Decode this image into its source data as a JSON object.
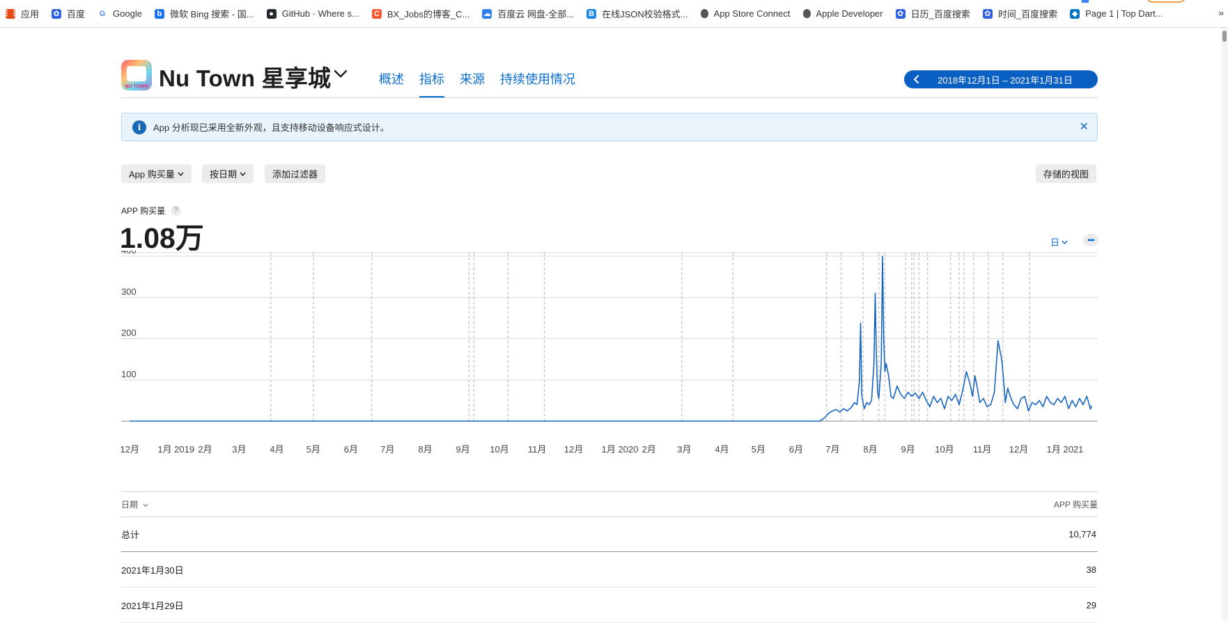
{
  "bookmarks": [
    {
      "label": "应用",
      "icon": "apps-grid-icon",
      "color": "#e64a19"
    },
    {
      "label": "百度",
      "icon": "baidu-paw-icon",
      "color": "#3062e0"
    },
    {
      "label": "Google",
      "icon": "google-icon",
      "color": "#4285f4"
    },
    {
      "label": "微软 Bing 搜索 - 国...",
      "icon": "bing-icon",
      "color": "#1a73e8"
    },
    {
      "label": "GitHub · Where s...",
      "icon": "github-icon",
      "color": "#24292e"
    },
    {
      "label": "BX_Jobs的博客_C...",
      "icon": "csdn-icon",
      "color": "#fc5531"
    },
    {
      "label": "百度云 网盘-全部...",
      "icon": "baidu-cloud-icon",
      "color": "#2f80ed"
    },
    {
      "label": "在线JSON校验格式...",
      "icon": "json-icon",
      "color": "#1e88e5"
    },
    {
      "label": "App Store Connect",
      "icon": "apple-icon",
      "color": "#333333"
    },
    {
      "label": "Apple Developer",
      "icon": "apple-icon",
      "color": "#333333"
    },
    {
      "label": "日历_百度搜索",
      "icon": "baidu-paw-icon",
      "color": "#3062e0"
    },
    {
      "label": "时间_百度搜索",
      "icon": "baidu-paw-icon",
      "color": "#3062e0"
    },
    {
      "label": "Page 1 | Top Dart...",
      "icon": "dart-icon",
      "color": "#0175c2"
    }
  ],
  "bookmarks_more": "»",
  "header": {
    "app_title": "Nu Town 星享城",
    "app_icon_caption": "NU TOWN",
    "tabs": [
      {
        "label": "概述",
        "active": false
      },
      {
        "label": "指标",
        "active": true
      },
      {
        "label": "来源",
        "active": false
      },
      {
        "label": "持续使用情况",
        "active": false
      }
    ],
    "date_range": "2018年12月1日 – 2021年1月31日"
  },
  "banner": {
    "text": "App 分析现已采用全新外观，且支持移动设备响应式设计。",
    "close": "✕"
  },
  "filters": {
    "metric": "App 购买量",
    "group_by": "按日期",
    "add_filter": "添加过滤器",
    "saved_views": "存储的视图"
  },
  "metric": {
    "label": "APP 购买量",
    "help": "?",
    "value": "1.08万",
    "granularity": "日",
    "more": "•••"
  },
  "colors": {
    "accent": "#0a6dd0",
    "line": "#1565c0",
    "pill": "#0a5fc2"
  },
  "chart_data": {
    "type": "line",
    "ylim": [
      0,
      400
    ],
    "y_ticks": [
      100,
      200,
      300,
      400
    ],
    "x_tick_labels": [
      "12月",
      "1月 2019",
      "2月",
      "3月",
      "4月",
      "5月",
      "6月",
      "7月",
      "8月",
      "9月",
      "10月",
      "11月",
      "12月",
      "1月 2020",
      "2月",
      "3月",
      "4月",
      "5月",
      "6月",
      "7月",
      "8月",
      "9月",
      "10月",
      "11月",
      "12月",
      "1月 2021"
    ],
    "series": [
      {
        "x": [
          "2018-12-01",
          "2020-06-20",
          "2020-06-22",
          "2020-06-25",
          "2020-06-28",
          "2020-07-01",
          "2020-07-04",
          "2020-07-07",
          "2020-07-10",
          "2020-07-13",
          "2020-07-16",
          "2020-07-19",
          "2020-07-21",
          "2020-07-23",
          "2020-07-24",
          "2020-07-25",
          "2020-07-27",
          "2020-07-29",
          "2020-07-31",
          "2020-08-02",
          "2020-08-04",
          "2020-08-05",
          "2020-08-06",
          "2020-08-07",
          "2020-08-08",
          "2020-08-10",
          "2020-08-11",
          "2020-08-12",
          "2020-08-13",
          "2020-08-14",
          "2020-08-16",
          "2020-08-18",
          "2020-08-20",
          "2020-08-23",
          "2020-08-26",
          "2020-08-29",
          "2020-09-01",
          "2020-09-04",
          "2020-09-07",
          "2020-09-10",
          "2020-09-13",
          "2020-09-16",
          "2020-09-19",
          "2020-09-22",
          "2020-09-25",
          "2020-09-28",
          "2020-10-01",
          "2020-10-04",
          "2020-10-07",
          "2020-10-10",
          "2020-10-13",
          "2020-10-16",
          "2020-10-19",
          "2020-10-22",
          "2020-10-24",
          "2020-10-26",
          "2020-10-28",
          "2020-10-30",
          "2020-11-02",
          "2020-11-05",
          "2020-11-08",
          "2020-11-11",
          "2020-11-14",
          "2020-11-17",
          "2020-11-19",
          "2020-11-20",
          "2020-11-22",
          "2020-11-24",
          "2020-11-27",
          "2020-11-30",
          "2020-12-03",
          "2020-12-06",
          "2020-12-09",
          "2020-12-12",
          "2020-12-15",
          "2020-12-18",
          "2020-12-21",
          "2020-12-24",
          "2020-12-27",
          "2020-12-30",
          "2021-01-02",
          "2021-01-05",
          "2021-01-08",
          "2021-01-11",
          "2021-01-14",
          "2021-01-17",
          "2021-01-20",
          "2021-01-23",
          "2021-01-26",
          "2021-01-29",
          "2021-01-30"
        ],
        "values": [
          0,
          0,
          3,
          10,
          20,
          25,
          28,
          22,
          30,
          25,
          32,
          45,
          40,
          95,
          238,
          60,
          30,
          45,
          40,
          50,
          140,
          310,
          160,
          70,
          55,
          140,
          400,
          200,
          120,
          140,
          110,
          60,
          55,
          85,
          65,
          55,
          70,
          60,
          68,
          55,
          70,
          50,
          35,
          60,
          45,
          55,
          30,
          60,
          50,
          65,
          40,
          75,
          120,
          90,
          60,
          110,
          80,
          45,
          55,
          35,
          40,
          70,
          195,
          150,
          85,
          45,
          80,
          60,
          40,
          30,
          55,
          60,
          25,
          45,
          40,
          50,
          35,
          60,
          45,
          40,
          55,
          45,
          60,
          30,
          50,
          35,
          55,
          40,
          60,
          29,
          38
        ]
      }
    ]
  },
  "table": {
    "col_date": "日期",
    "col_metric": "APP 购买量",
    "total_label": "总计",
    "total_value": "10,774",
    "rows": [
      {
        "date": "2021年1月30日",
        "value": "38"
      },
      {
        "date": "2021年1月29日",
        "value": "29"
      }
    ]
  }
}
